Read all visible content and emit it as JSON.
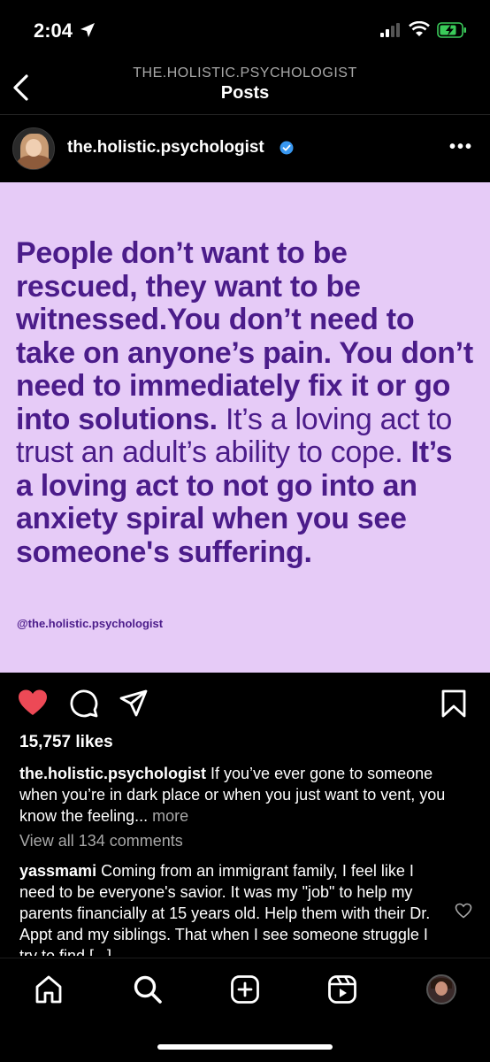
{
  "status_bar": {
    "time": "2:04"
  },
  "nav": {
    "overline": "THE.HOLISTIC.PSYCHOLOGIST",
    "title": "Posts"
  },
  "post": {
    "username": "the.holistic.psychologist",
    "image": {
      "quote_segments": [
        {
          "text": "People don’t want to be rescued, they want to be witnessed.You don’t need to take on anyone’s pain. You don’t need to immediately fix it or go into solutions.",
          "weight": "bold"
        },
        {
          "text": " It’s a loving act to trust an adult’s ability to cope. ",
          "weight": "normal"
        },
        {
          "text": "It’s a loving act to not go into an anxiety spiral when you see someone's suffering.",
          "weight": "bold"
        }
      ],
      "handle": "@the.holistic.psychologist",
      "background_color": "#e6cbf7",
      "text_color": "#4b1c8a"
    },
    "liked": true,
    "likes": "15,757 likes",
    "caption": {
      "username": "the.holistic.psychologist",
      "text": " If you’ve ever gone to someone when you’re in dark place or when you just want to vent, you know the feeling...",
      "more": " more"
    },
    "view_all_comments": "View all 134 comments",
    "top_comment": {
      "username": "yassmami",
      "text": " Coming from an immigrant family, I feel like I need to be everyone's savior. It was my \"job\" to help my parents financially at 15 years old. Help them with their Dr. Appt and my siblings. That when I see someone struggle I try to find [...]"
    }
  },
  "tab_bar": {
    "items": [
      "home-icon",
      "search-icon",
      "create-icon",
      "reels-icon",
      "profile-avatar"
    ]
  },
  "colors": {
    "like_red": "#ed4956",
    "verified_blue": "#3897f0",
    "secondary_text": "#a8a8a8"
  }
}
